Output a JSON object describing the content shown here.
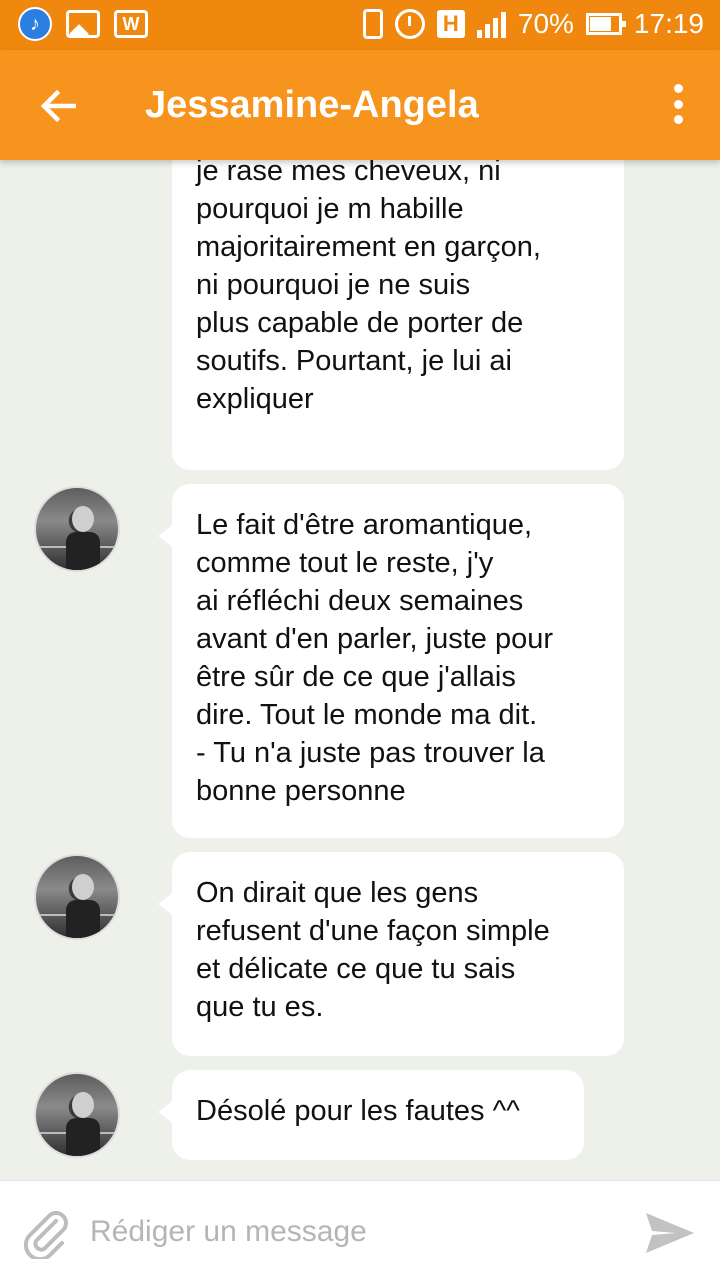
{
  "status_bar": {
    "battery": "70%",
    "time": "17:19",
    "network_badge": "H",
    "icons_left": [
      "music-icon",
      "image-icon",
      "w-app-icon"
    ],
    "icons_right": [
      "vibrate-icon",
      "alarm-icon",
      "network-h-icon",
      "signal-icon",
      "battery-icon"
    ]
  },
  "header": {
    "title": "Jessamine-Angela",
    "back_icon": "arrow-left-icon",
    "menu_icon": "more-vert-icon"
  },
  "messages": [
    {
      "text": "Elle comprend pas pourquoi\nje rase mes cheveux, ni\npourquoi je m habille\nmajoritairement en garçon,\nni pourquoi je ne suis\nplus capable de porter de\nsoutifs. Pourtant, je lui ai\nexpliquer",
      "has_avatar": false
    },
    {
      "text": "Le fait d'être aromantique,\ncomme tout le reste, j'y\nai réfléchi deux semaines\navant d'en parler, juste pour\nêtre sûr de ce que j'allais\ndire. Tout le monde ma dit.\n- Tu n'a juste pas trouver la\nbonne personne",
      "has_avatar": true
    },
    {
      "text": "On dirait que les gens\nrefusent d'une façon simple\net délicate ce que tu sais\nque tu es.",
      "has_avatar": true
    },
    {
      "text": "Désolé pour les fautes ^^",
      "has_avatar": true
    }
  ],
  "composer": {
    "placeholder": "Rédiger un message",
    "attach_icon": "paperclip-icon",
    "send_icon": "send-icon"
  },
  "colors": {
    "status_bar": "#f0880f",
    "app_bar": "#f7941d",
    "background": "#eef1ea",
    "bubble": "#ffffff"
  }
}
